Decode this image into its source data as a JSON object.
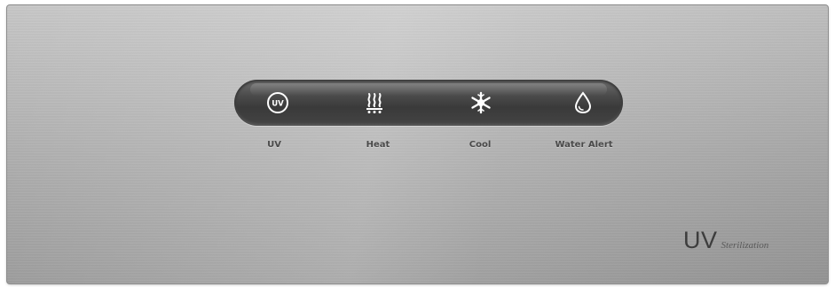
{
  "control_panel": {
    "buttons": [
      {
        "id": "uv",
        "icon": "uv-icon",
        "icon_text": "UV",
        "label": "UV"
      },
      {
        "id": "heat",
        "icon": "heat-icon",
        "label": "Heat"
      },
      {
        "id": "cool",
        "icon": "snowflake-icon",
        "label": "Cool"
      },
      {
        "id": "water_alert",
        "icon": "water-drop-icon",
        "label": "Water Alert"
      }
    ]
  },
  "brand": {
    "main": "UV",
    "sub": "Sterilization"
  },
  "colors": {
    "panel": "#ababab",
    "bar": "#444444",
    "icon": "#ffffff",
    "label": "#4a4a4a"
  }
}
